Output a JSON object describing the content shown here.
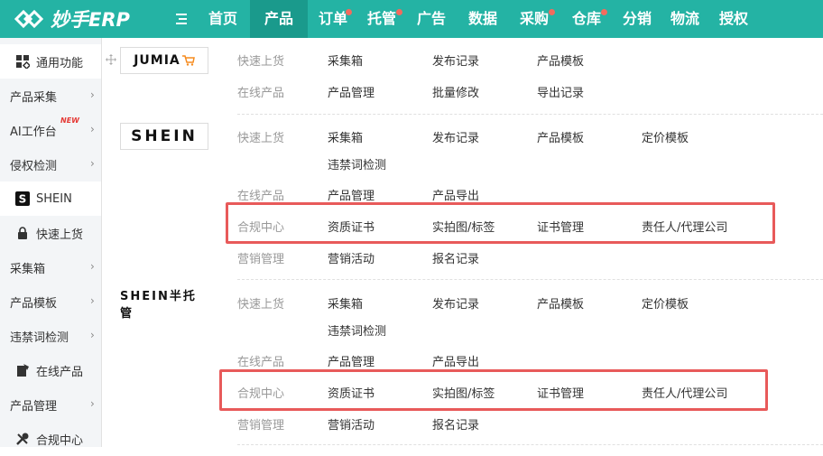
{
  "app": {
    "logo_text": "妙手ERP",
    "colors": {
      "header_bg": "#24b3a4",
      "active_tab_bg": "#1a9a8c",
      "notification_dot": "#f26b5e",
      "highlight_border": "#e85a5a"
    }
  },
  "nav": {
    "items": [
      {
        "label": "首页",
        "active": false,
        "dot": false
      },
      {
        "label": "产品",
        "active": true,
        "dot": false
      },
      {
        "label": "订单",
        "active": false,
        "dot": true
      },
      {
        "label": "托管",
        "active": false,
        "dot": true
      },
      {
        "label": "广告",
        "active": false,
        "dot": false
      },
      {
        "label": "数据",
        "active": false,
        "dot": false
      },
      {
        "label": "采购",
        "active": false,
        "dot": true
      },
      {
        "label": "仓库",
        "active": false,
        "dot": true
      },
      {
        "label": "分销",
        "active": false,
        "dot": false
      },
      {
        "label": "物流",
        "active": false,
        "dot": false
      },
      {
        "label": "授权",
        "active": false,
        "dot": false
      }
    ]
  },
  "sidebar": {
    "items": [
      {
        "label": "通用功能",
        "icon": "grid-icon"
      },
      {
        "label": "产品采集",
        "icon": ""
      },
      {
        "label": "AI工作台",
        "icon": "",
        "badge": "NEW"
      },
      {
        "label": "侵权检测",
        "icon": ""
      },
      {
        "label": "SHEIN",
        "icon": "shein-icon"
      },
      {
        "label": "快速上货",
        "icon": "lock-icon"
      },
      {
        "label": "采集箱",
        "icon": ""
      },
      {
        "label": "产品模板",
        "icon": ""
      },
      {
        "label": "违禁词检测",
        "icon": ""
      },
      {
        "label": "在线产品",
        "icon": "tag-icon"
      },
      {
        "label": "产品管理",
        "icon": ""
      },
      {
        "label": "合规中心",
        "icon": "tools-icon"
      }
    ]
  },
  "platforms": {
    "jumia": {
      "brand": "JUMIA",
      "quick": {
        "label": "快速上货",
        "links": [
          "采集箱",
          "发布记录",
          "产品模板"
        ]
      },
      "online": {
        "label": "在线产品",
        "links": [
          "产品管理",
          "批量修改",
          "导出记录"
        ]
      }
    },
    "shein": {
      "brand": "SHEIN",
      "quick": {
        "label": "快速上货",
        "links": [
          "采集箱",
          "发布记录",
          "产品模板",
          "定价模板",
          "违禁词检测"
        ]
      },
      "online": {
        "label": "在线产品",
        "links": [
          "产品管理",
          "产品导出"
        ]
      },
      "compliance": {
        "label": "合规中心",
        "links": [
          "资质证书",
          "实拍图/标签",
          "证书管理",
          "责任人/代理公司"
        ]
      },
      "marketing": {
        "label": "营销管理",
        "links": [
          "营销活动",
          "报名记录"
        ]
      }
    },
    "shein_semi": {
      "brand": "SHEIN半托管",
      "quick": {
        "label": "快速上货",
        "links": [
          "采集箱",
          "发布记录",
          "产品模板",
          "定价模板",
          "违禁词检测"
        ]
      },
      "online": {
        "label": "在线产品",
        "links": [
          "产品管理",
          "产品导出"
        ]
      },
      "compliance": {
        "label": "合规中心",
        "links": [
          "资质证书",
          "实拍图/标签",
          "证书管理",
          "责任人/代理公司"
        ]
      },
      "marketing": {
        "label": "营销管理",
        "links": [
          "营销活动",
          "报名记录"
        ]
      }
    }
  }
}
